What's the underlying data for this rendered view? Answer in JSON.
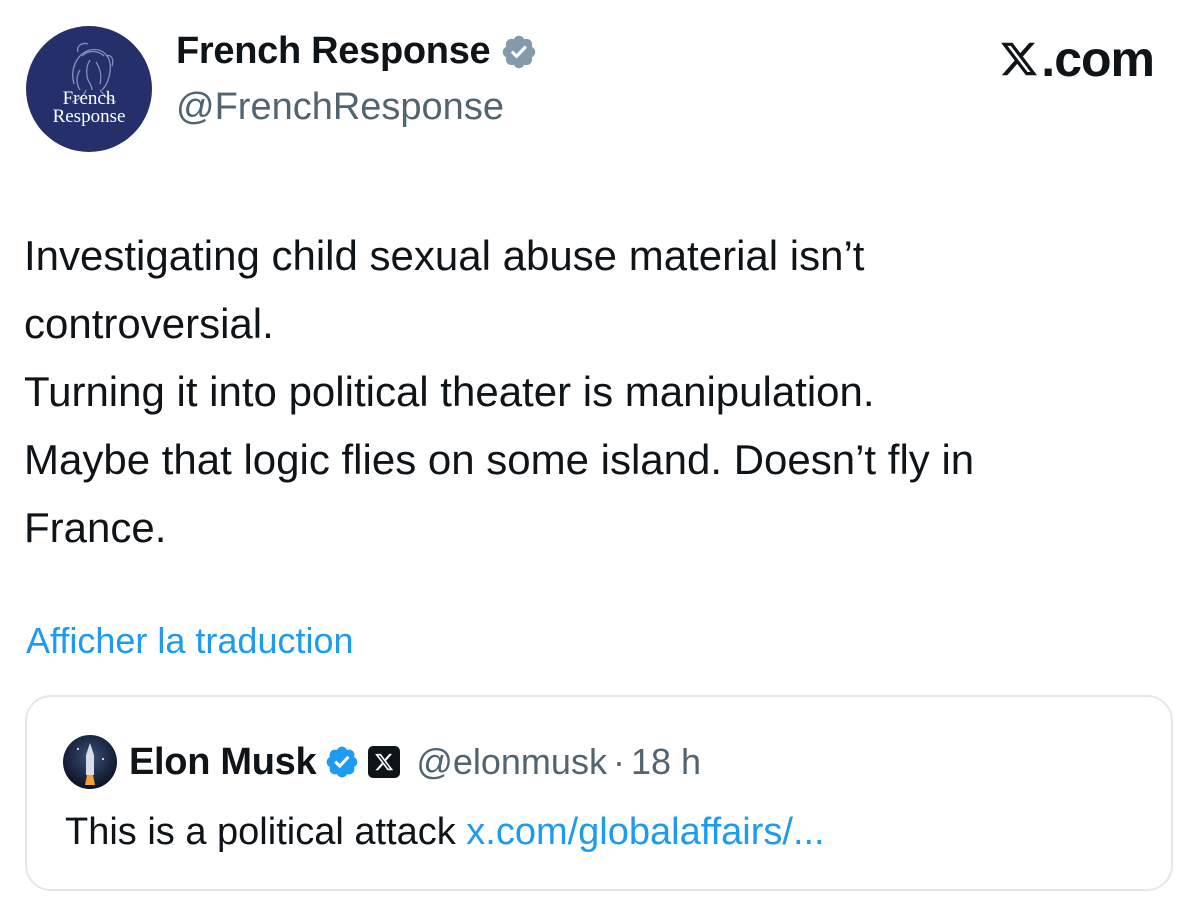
{
  "author": {
    "avatar_text_line1": "French",
    "avatar_text_line2": "Response",
    "display_name": "French Response",
    "handle": "@FrenchResponse",
    "verified_badge": "grey-verified-icon"
  },
  "brand": {
    "label": ".com",
    "icon": "x-logo-icon"
  },
  "tweet": {
    "lines": [
      "Investigating child sexual abuse material isn’t",
      "controversial.",
      "Turning it into political theater is manipulation.",
      "Maybe that logic flies on some island. Doesn’t fly in",
      "France."
    ],
    "translate_label": "Afficher la traduction"
  },
  "quoted": {
    "display_name": "Elon Musk",
    "handle": "@elonmusk",
    "separator": "·",
    "time": "18 h",
    "text": "This is a political attack ",
    "link": "x.com/globalaffairs/..."
  },
  "colors": {
    "link": "#1d9bf0",
    "secondary_text": "#536471",
    "avatar_bg": "#25306b",
    "verified_grey": "#829aab",
    "verified_blue": "#1d9bf0",
    "border": "#e5e7ea"
  }
}
